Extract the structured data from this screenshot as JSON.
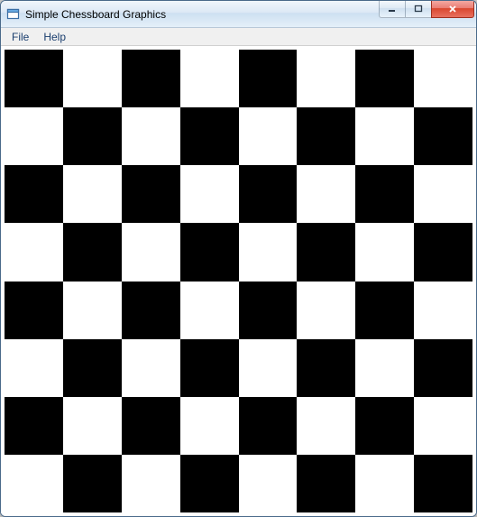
{
  "window": {
    "title": "Simple Chessboard Graphics"
  },
  "menu": {
    "file": "File",
    "help": "Help"
  },
  "board": {
    "rows": 8,
    "cols": 8,
    "dark_color": "#000000",
    "light_color": "#ffffff"
  }
}
